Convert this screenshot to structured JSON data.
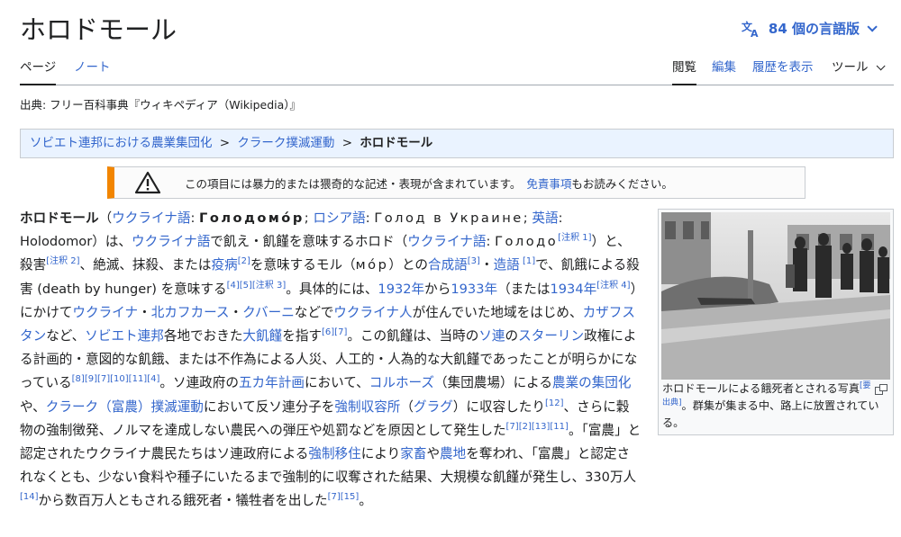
{
  "page": {
    "title": "ホロドモール",
    "languages_label": "84 個の言語版"
  },
  "tabs": {
    "article": "ページ",
    "talk": "ノート",
    "read": "閲覧",
    "edit": "編集",
    "history": "履歴を表示",
    "tools": "ツール"
  },
  "source_line": "出典: フリー百科事典『ウィキペディア（Wikipedia）』",
  "breadcrumb": {
    "item1": "ソビエト連邦における農業集団化",
    "item2": "クラーク撲滅運動",
    "current": "ホロドモール",
    "separator": ">"
  },
  "warning": {
    "text": "この項目には暴力的または猥奇的な記述・表現が含まれています。",
    "link": "免責事項",
    "suffix": "もお読みください。"
  },
  "article": {
    "t01": "ホロドモール",
    "t02": "（",
    "t03": "ウクライナ語",
    "t04": ": ",
    "t05": "Голодомо́р",
    "t06": "; ",
    "t07": "ロシア語",
    "t08": ": ",
    "t09": "Голод в Украине",
    "t10": "; ",
    "t11": "英語",
    "t12": ": Holodomor）は、",
    "t13": "ウクライナ語",
    "t14": "で飢え・飢饉を意味するホロド（",
    "t15": "ウクライナ語",
    "t16": ": ",
    "t17": "Голодо",
    "t18": "[注釈 1]",
    "t19": "）と、殺害",
    "t20": "[注釈 2]",
    "t21": "、絶滅、抹殺、または",
    "t22": "疫病",
    "t23": "[2]",
    "t24": "を意味するモル（",
    "t25": "мо́р",
    "t26": "）との",
    "t27": "合成語",
    "t28": "[3]",
    "t29": "・",
    "t30": "造語",
    "t31": " [1]",
    "t32": "で、飢餓による殺害 (death by hunger) を意味する",
    "t33": "[4][5][注釈 3]",
    "t34": "。具体的には、",
    "t35": "1932年",
    "t36": "から",
    "t37": "1933年",
    "t38": "（または",
    "t39": "1934年",
    "t40": "[注釈 4]",
    "t41": "）にかけて",
    "t42": "ウクライナ",
    "t43": "・",
    "t44": "北カフカース",
    "t45": "・",
    "t46": "クバーニ",
    "t47": "などで",
    "t48": "ウクライナ人",
    "t49": "が住んでいた地域をはじめ、",
    "t50": "カザフスタン",
    "t51": "など、",
    "t52": "ソビエト連邦",
    "t53": "各地でおきた",
    "t54": "大飢饉",
    "t55": "を指す",
    "t56": "[6][7]",
    "t57": "。この飢饉は、当時の",
    "t58": "ソ連",
    "t59": "の",
    "t60": "スターリン",
    "t61": "政権による計画的・意図的な飢餓、または不作為による人災、人工的・人為的な大飢饉であったことが明らかになっている",
    "t62": "[8][9][7][10][11][4]",
    "t63": "。ソ連政府の",
    "t64": "五カ年計画",
    "t65": "において、",
    "t66": "コルホーズ",
    "t67": "（集団農場）による",
    "t68": "農業の集団化",
    "t69": "や、",
    "t70": "クラーク（富農）撲滅運動",
    "t71": "において反ソ連分子を",
    "t72": "強制収容所",
    "t73": "（",
    "t74": "グラグ",
    "t75": "）に収容したり",
    "t76": "[12]",
    "t77": "、さらに穀物の強制徴発、ノルマを達成しない農民への弾圧や処罰などを原因として発生した",
    "t78": "[7][2][13][11]",
    "t79": "。「富農」と認定されたウクライナ農民たちはソ連政府による",
    "t80": "強制移住",
    "t81": "により",
    "t82": "家畜",
    "t83": "や",
    "t84": "農地",
    "t85": "を奪われ、「富農」と認定されなくとも、少ない食料や種子にいたるまで強制的に収奪された結果、大規模な飢饉が発生し、330万人",
    "t86": "[14]",
    "t87": "から数百万人ともされる餓死者・犠牲者を出した",
    "t88": "[7][15]",
    "t89": "。"
  },
  "thumb": {
    "caption_a": "ホロドモールによる餓死者とされる写真",
    "caption_ref": "[要出典]",
    "caption_b": "。群集が集まる中、路上に放置されている。"
  },
  "colors": {
    "link": "#3366cc",
    "text": "#202122",
    "breadcrumb_bg": "#eaf3ff",
    "warning_bar": "#f28500"
  },
  "icons": {
    "language": "translate-icon",
    "warning": "warning-triangle-icon",
    "enlarge": "enlarge-icon"
  }
}
